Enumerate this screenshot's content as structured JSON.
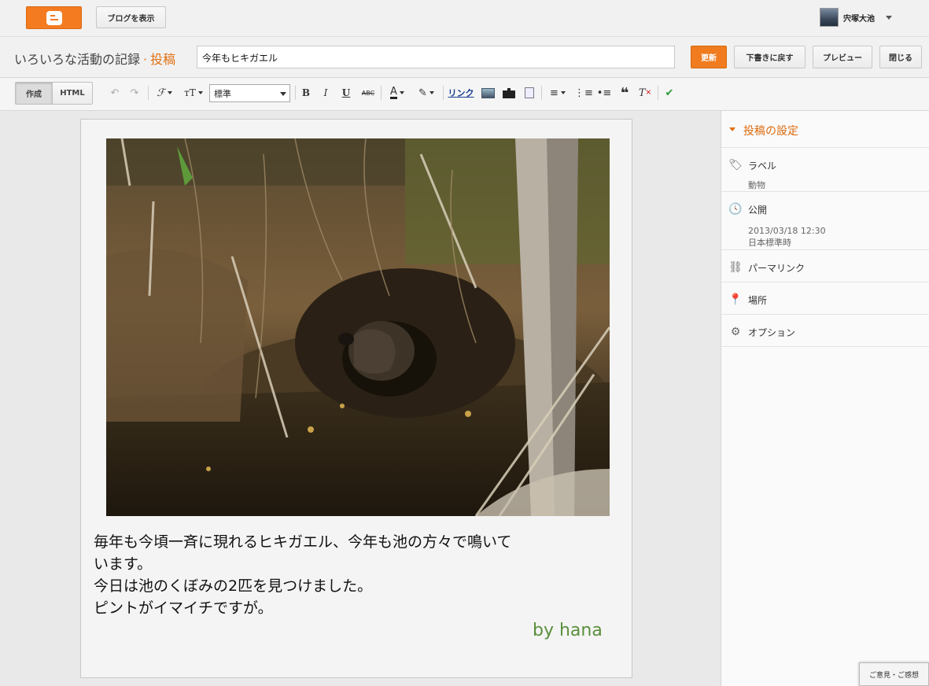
{
  "app": {
    "view_blog_label": "ブログを表示",
    "user_name": "宍塚大池"
  },
  "header": {
    "blog_name": "いろいろな活動の記録",
    "separator": "·",
    "section": "投稿",
    "post_title": "今年もヒキガエル",
    "update_label": "更新",
    "revert_label": "下書きに戻す",
    "preview_label": "プレビュー",
    "close_label": "閉じる"
  },
  "toolbar": {
    "compose_label": "作成",
    "html_label": "HTML",
    "font_size_select": "標準",
    "link_label": "リンク",
    "bold": "B",
    "italic": "I",
    "underline": "U",
    "strike": "ABC"
  },
  "post": {
    "body_line1": "毎年も今頃一斉に現れるヒキガエル、今年も池の方々で鳴いて",
    "body_line2": "います。",
    "body_line3": "今日は池のくぼみの2匹を見つけました。",
    "body_line4": "ピントがイマイチですが。",
    "signature": "by hana"
  },
  "sidebar": {
    "title": "投稿の設定",
    "labels_title": "ラベル",
    "labels_value": "動物",
    "publish_title": "公開",
    "publish_datetime": "2013/03/18 12:30",
    "publish_tz": "日本標準時",
    "permalink_title": "パーマリンク",
    "location_title": "場所",
    "options_title": "オプション"
  },
  "feedback_label": "ご意見・ご感想",
  "colors": {
    "brand": "#f47b20",
    "accent": "#dd6a0d",
    "signature": "#5a8f3b"
  }
}
